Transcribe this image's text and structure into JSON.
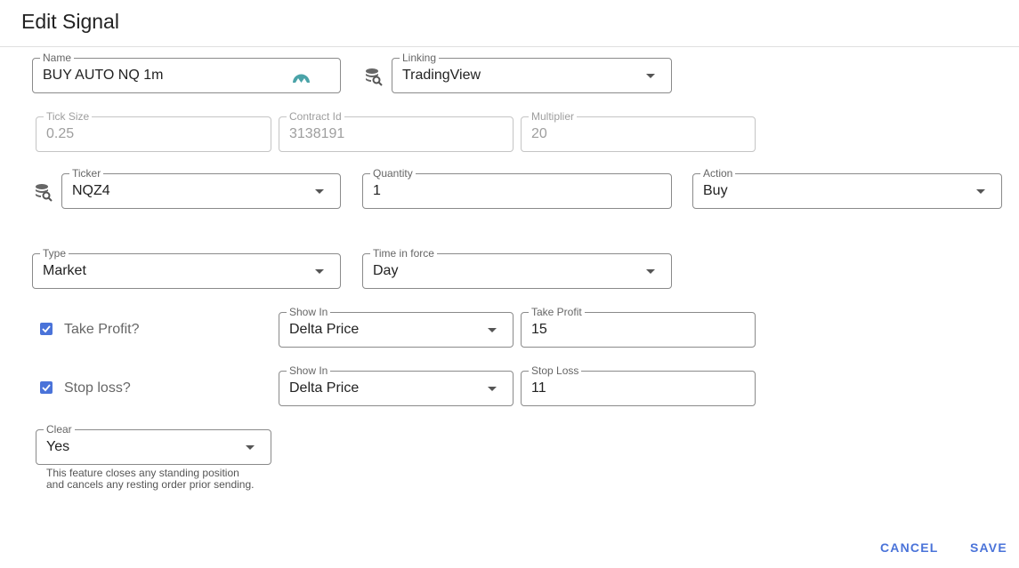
{
  "dialog": {
    "title": "Edit Signal"
  },
  "fields": {
    "name": {
      "label": "Name",
      "value": "BUY AUTO NQ 1m"
    },
    "linking": {
      "label": "Linking",
      "value": "TradingView"
    },
    "tick_size": {
      "label": "Tick Size",
      "value": "0.25"
    },
    "contract_id": {
      "label": "Contract Id",
      "value": "3138191"
    },
    "multiplier": {
      "label": "Multiplier",
      "value": "20"
    },
    "ticker": {
      "label": "Ticker",
      "value": "NQZ4"
    },
    "quantity": {
      "label": "Quantity",
      "value": "1"
    },
    "action": {
      "label": "Action",
      "value": "Buy"
    },
    "type": {
      "label": "Type",
      "value": "Market"
    },
    "time_in_force": {
      "label": "Time in force",
      "value": "Day"
    },
    "take_profit_show_in": {
      "label": "Show In",
      "value": "Delta Price"
    },
    "take_profit": {
      "label": "Take Profit",
      "value": "15"
    },
    "stop_loss_show_in": {
      "label": "Show In",
      "value": "Delta Price"
    },
    "stop_loss": {
      "label": "Stop Loss",
      "value": "11"
    },
    "clear": {
      "label": "Clear",
      "value": "Yes",
      "helper_line1": "This feature closes any standing position",
      "helper_line2": "and cancels any resting order prior sending."
    }
  },
  "checkboxes": {
    "take_profit": {
      "label": "Take Profit?",
      "checked": true
    },
    "stop_loss": {
      "label": "Stop loss?",
      "checked": true
    }
  },
  "icons": {
    "name_adornment": "tradingview-logo-icon",
    "linking_search": "database-search-icon",
    "ticker_search": "database-search-icon"
  },
  "colors": {
    "accent": "#4a73d9",
    "logo": "#4aa3a8"
  },
  "actions": {
    "cancel_label": "CANCEL",
    "save_label": "SAVE"
  }
}
